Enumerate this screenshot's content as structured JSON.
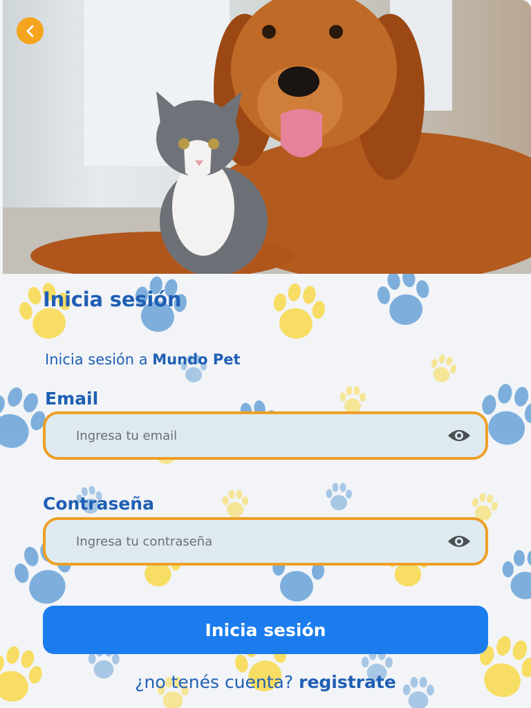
{
  "header": {
    "back_icon": "chevron-left-icon",
    "back_color": "#f5a41e"
  },
  "hero": {
    "subject": "dog-and-cat-photo"
  },
  "form": {
    "title": "Inicia sesión",
    "subtitle_prefix": "Inicia sesión a ",
    "subtitle_brand": "Mundo Pet",
    "email": {
      "label": "Email",
      "placeholder": "Ingresa tu email",
      "value": "",
      "icon": "eye-icon"
    },
    "password": {
      "label": "Contraseña",
      "placeholder": "Ingresa tu contraseña",
      "value": "",
      "icon": "eye-icon"
    },
    "submit_label": "Inicia sesión",
    "signup_prompt": "¿no tenés cuenta?",
    "signup_link": "registrate"
  },
  "colors": {
    "primary_text": "#1f5fb4",
    "button": "#1b7ced",
    "field_border": "#ee9f25",
    "field_bg": "#deeaf0",
    "paw_yellow": "#f9d94a",
    "paw_blue": "#6aa3d8"
  }
}
